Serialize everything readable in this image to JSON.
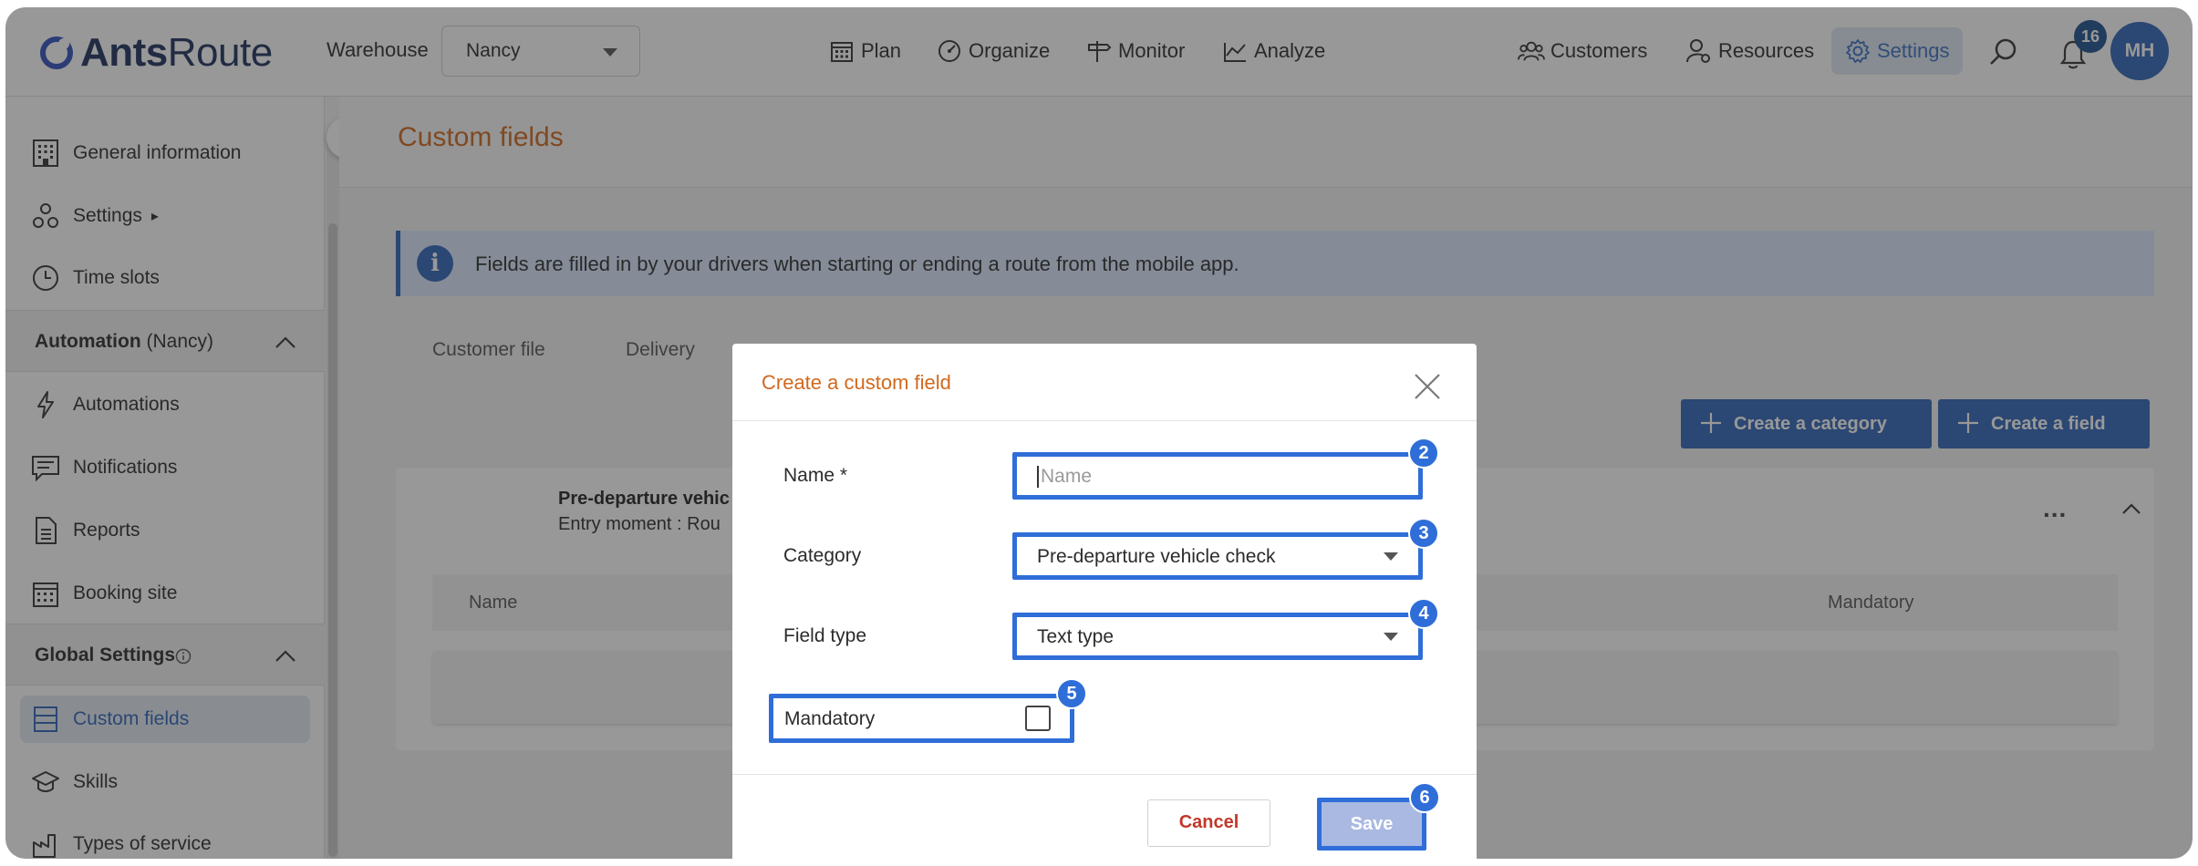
{
  "brand": {
    "name_bold": "Ants",
    "name_regular": "Route",
    "accent": "#1c2f5c"
  },
  "header": {
    "warehouse_label": "Warehouse",
    "warehouse_value": "Nancy",
    "nav": {
      "plan": "Plan",
      "organize": "Organize",
      "monitor": "Monitor",
      "analyze": "Analyze",
      "customers": "Customers",
      "resources": "Resources",
      "settings": "Settings"
    },
    "notification_count": "16",
    "avatar_initials": "MH"
  },
  "sidebar": {
    "items_top": [
      {
        "label": "General information",
        "icon": "building-icon"
      },
      {
        "label": "Settings",
        "icon": "settings-nodes-icon",
        "arrow": "▸"
      },
      {
        "label": "Time slots",
        "icon": "clock-icon"
      }
    ],
    "automation": {
      "title": "Automation",
      "sub": "(Nancy)",
      "items": [
        {
          "label": "Automations",
          "icon": "lightning-icon"
        },
        {
          "label": "Notifications",
          "icon": "message-icon"
        },
        {
          "label": "Reports",
          "icon": "document-icon"
        },
        {
          "label": "Booking site",
          "icon": "calendar-icon"
        }
      ]
    },
    "global": {
      "title": "Global Settings",
      "items": [
        {
          "label": "Custom fields",
          "icon": "list-icon",
          "active": true
        },
        {
          "label": "Skills",
          "icon": "graduation-cap-icon"
        },
        {
          "label": "Types of service",
          "icon": "factory-icon"
        }
      ]
    }
  },
  "main": {
    "page_title": "Custom fields",
    "info_text": "Fields are filled in by your drivers when starting or ending a route from the mobile app.",
    "tabs": [
      "Customer file",
      "Delivery"
    ],
    "create_category_label": "Create a category",
    "create_field_label": "Create a field",
    "card": {
      "title": "Pre-departure vehic",
      "subtitle": "Entry moment : Rou",
      "columns": {
        "name": "Name",
        "mandatory": "Mandatory"
      },
      "more": "..."
    }
  },
  "modal": {
    "title": "Create a custom field",
    "fields": {
      "name_label": "Name *",
      "name_placeholder": "Name",
      "category_label": "Category",
      "category_value": "Pre-departure vehicle check",
      "type_label": "Field type",
      "type_value": "Text type",
      "mandatory_label": "Mandatory"
    },
    "cancel_label": "Cancel",
    "save_label": "Save",
    "badges": [
      "2",
      "3",
      "4",
      "5",
      "6"
    ]
  },
  "colors": {
    "primary": "#2f64b8",
    "title_orange": "#d1691d",
    "highlight": "#2f6ed8"
  }
}
